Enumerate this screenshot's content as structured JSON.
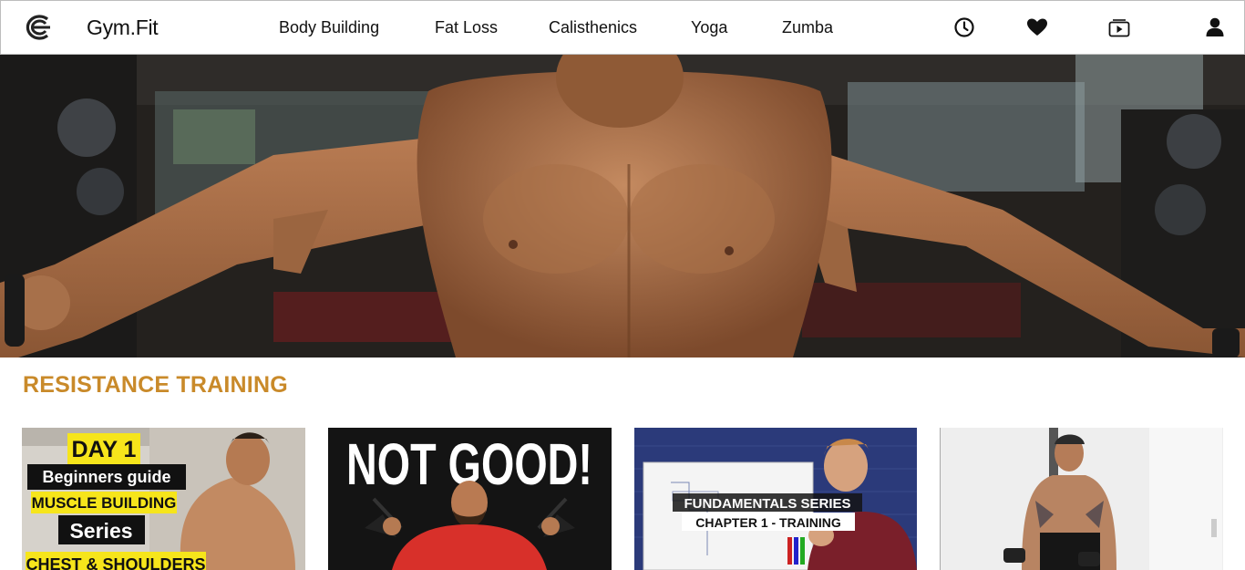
{
  "app": {
    "brand": "Gym.Fit"
  },
  "nav": {
    "items": [
      {
        "label": "Body Building"
      },
      {
        "label": "Fat Loss"
      },
      {
        "label": "Calisthenics"
      },
      {
        "label": "Yoga"
      },
      {
        "label": "Zumba"
      }
    ],
    "icons": [
      "clock-icon",
      "heart-icon",
      "video-library-icon",
      "user-icon"
    ]
  },
  "section": {
    "title": "RESISTANCE TRAINING"
  },
  "videos": [
    {
      "lines": [
        "DAY 1",
        "Beginners guide",
        "MUSCLE BUILDING",
        "Series",
        "CHEST & SHOULDERS"
      ]
    },
    {
      "lines": [
        "NOT GOOD!"
      ]
    },
    {
      "lines": [
        "FUNDAMENTALS SERIES",
        "CHAPTER 1 - TRAINING"
      ]
    },
    {
      "lines": []
    }
  ],
  "colors": {
    "accent": "#c98a2a",
    "thumb_yellow": "#f6e51b",
    "shirt_red": "#d8302a"
  }
}
